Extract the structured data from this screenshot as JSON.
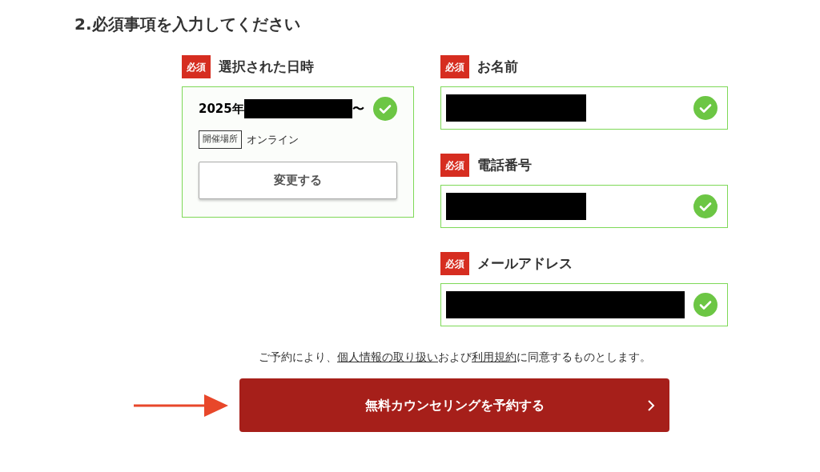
{
  "heading": "2.必須事項を入力してください",
  "datetime": {
    "required_badge": "必須",
    "label": "選択された日時",
    "date_prefix": "2025年",
    "date_redacted": true,
    "date_suffix": "〜",
    "valid": true,
    "venue_tag": "開催場所",
    "venue": "オンライン",
    "change_button": "変更する"
  },
  "fields": [
    {
      "required_badge": "必須",
      "label": "お名前",
      "redacted": true,
      "valid": true
    },
    {
      "required_badge": "必須",
      "label": "電話番号",
      "redacted": true,
      "valid": true
    },
    {
      "required_badge": "必須",
      "label": "メールアドレス",
      "redacted": true,
      "valid": true
    }
  ],
  "consent": {
    "before": "ご予約により、",
    "link_1": "個人情報の取り扱い",
    "middle": "および",
    "link_2": "利用規約",
    "after": "に同意するものとします。"
  },
  "submit_button": "無料カウンセリングを予約する"
}
